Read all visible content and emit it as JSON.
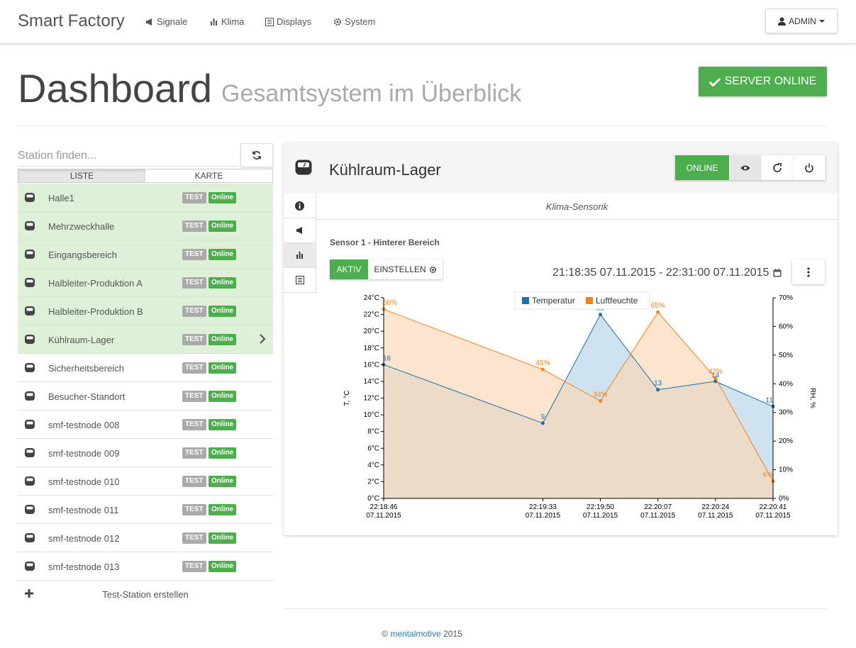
{
  "app": {
    "brand": "Smart Factory"
  },
  "nav": {
    "items": [
      {
        "label": "Signale",
        "icon": "megaphone-icon"
      },
      {
        "label": "Klima",
        "icon": "bar-chart-icon"
      },
      {
        "label": "Displays",
        "icon": "list-icon"
      },
      {
        "label": "System",
        "icon": "gear-icon"
      }
    ],
    "user": {
      "label": "ADMIN",
      "icon": "user-icon"
    }
  },
  "header": {
    "title": "Dashboard",
    "subtitle": "Gesamtsystem im Überblick",
    "server_status": "SERVER ONLINE"
  },
  "sidebar": {
    "search_placeholder": "Station finden...",
    "tabs": [
      "LISTE",
      "KARTE"
    ],
    "badge_test": "TEST",
    "badge_online": "Online",
    "stations": [
      {
        "name": "Halle1",
        "highlight": true
      },
      {
        "name": "Mehrzweckhalle",
        "highlight": true
      },
      {
        "name": "Eingangsbereich",
        "highlight": true
      },
      {
        "name": "Halbleiter-Produktion A",
        "highlight": true
      },
      {
        "name": "Halbleiter-Produktion B",
        "highlight": true
      },
      {
        "name": "Kühlraum-Lager",
        "highlight": true,
        "selected": true
      },
      {
        "name": "Sicherheitsbereich",
        "highlight": false
      },
      {
        "name": "Besucher-Standort",
        "highlight": false
      },
      {
        "name": "smf-testnode 008",
        "highlight": false
      },
      {
        "name": "smf-testnode 009",
        "highlight": false
      },
      {
        "name": "smf-testnode 010",
        "highlight": false
      },
      {
        "name": "smf-testnode 011",
        "highlight": false
      },
      {
        "name": "smf-testnode 012",
        "highlight": false
      },
      {
        "name": "smf-testnode 013",
        "highlight": false
      }
    ],
    "add_station": "Test-Station erstellen"
  },
  "panel": {
    "title": "Kühlraum-Lager",
    "status": "ONLINE",
    "section": "Klima-Sensorik",
    "sensor": "Sensor 1 - Hinterer Bereich",
    "toggle_active": "AKTIV",
    "toggle_settings": "EINSTELLEN",
    "daterange": "21:18:35 07.11.2015 - 22:31:00 07.11.2015"
  },
  "colors": {
    "green": "#4cae4c",
    "highlight": "#dff0d8",
    "temperature": "#1f6fa5",
    "humidity": "#f5821f"
  },
  "chart_data": {
    "type": "area",
    "x": [
      "22:18:46 07.11.2015",
      "22:19:33 07.11.2015",
      "22:19:50 07.11.2015",
      "22:20:07 07.11.2015",
      "22:20:24 07.11.2015",
      "22:20:41 07.11.2015"
    ],
    "x_seconds": [
      0,
      47,
      64,
      81,
      98,
      115
    ],
    "y_left": {
      "label": "T, °C",
      "min": 0,
      "max": 24,
      "step": 2,
      "unit": "°C"
    },
    "y_right": {
      "label": "RH, %",
      "min": 0,
      "max": 70,
      "step": 10,
      "unit": "%"
    },
    "series": [
      {
        "name": "Temperatur",
        "axis": "left",
        "color": "#1f6fa5",
        "fill": "#b9d5ea",
        "values": [
          16,
          9,
          22,
          13,
          14,
          11
        ]
      },
      {
        "name": "Luftfeuchte",
        "axis": "right",
        "color": "#f5821f",
        "fill": "#fbd9b9",
        "values": [
          66,
          45,
          34,
          65,
          42,
          6
        ]
      }
    ],
    "legend": "top",
    "grid": false
  },
  "footer": {
    "copyright": "©",
    "link": "mentalmotive",
    "year": "2015"
  }
}
